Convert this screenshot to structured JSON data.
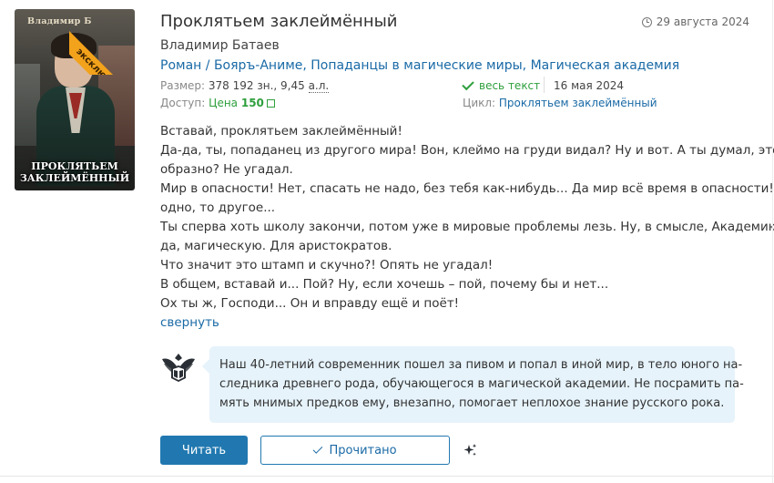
{
  "book": {
    "title": "Проклятьем заклеймённый",
    "date": "29 августа 2024",
    "author": "Владимир Батаев",
    "genres": [
      "Роман",
      "Бояръ-Аниме",
      "Попаданцы в магические миры",
      "Магическая академия"
    ],
    "genre_sep_1": " / ",
    "genre_sep": ", ",
    "size_label": "Размер:",
    "size_value": "378 192 зн., 9,45",
    "size_unit": "а.л.",
    "access_label": "Доступ:",
    "price_label": "Цена",
    "price_value": "150",
    "fulltext_label": "весь текст",
    "pub_date": "16 мая 2024",
    "cycle_label": "Цикл:",
    "cycle_name": "Проклятьем заклеймённый"
  },
  "cover": {
    "author_text": "Владимир Б",
    "title_line1": "ПРОКЛЯТЬЕМ",
    "title_line2": "ЗАКЛЕЙМЁННЫЙ",
    "badge": "эксклюзив",
    "badge_color": "#f2a21b"
  },
  "annotation": [
    "Вставай, проклятьем заклеймённый!",
    "Да-да, ты, попаданец из другого мира! Вон, клеймо на груди видал? Ну и вот. А ты думал, это так,",
    "образно? Не угадал.",
    "Мир в опасности! Нет, спасать не надо, без тебя как-нибудь... Да мир всё время в опасности! То",
    "одно, то другое...",
    "Ты сперва хоть школу закончи, потом уже в мировые проблемы лезь. Ну, в смысле, Академию. Ну",
    "да, магическую. Для аристократов.",
    "Что значит это штамп и скучно?! Опять не угадал!",
    "В общем, вставай и... Пой? Ну, если хочешь – пой, почему бы и нет...",
    "Ох ты ж, Господи... Он и вправду ещё и поёт!"
  ],
  "collapse_label": "свернуть",
  "review": {
    "lines": [
      "Наш 40-летний современник пошел за пивом и попал в иной мир, в тело юного на-",
      "следника древнего рода, обучающегося в магической академии. Не посрамить па-",
      "мять мнимых предков ему, внезапно, помогает неплохое знание русского рока."
    ]
  },
  "buttons": {
    "read": "Читать",
    "done": "Прочитано"
  },
  "colors": {
    "link": "#1a6aa6",
    "primary": "#2178b0",
    "green": "#2e9f3d",
    "bubble": "#e6f3fb"
  },
  "icons": [
    "clock-icon",
    "check-icon",
    "eagle-emblem-icon",
    "sparkle-icon"
  ]
}
